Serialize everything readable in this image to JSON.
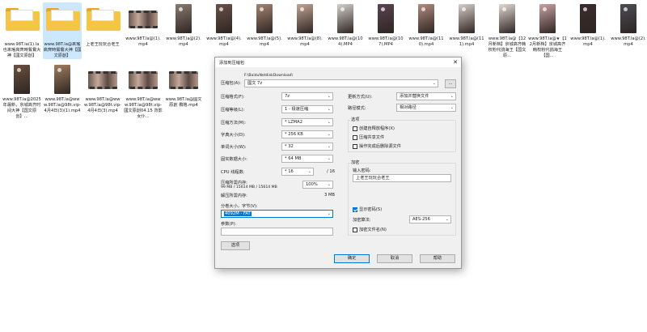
{
  "desktop": {
    "files": [
      {
        "label": "www.98T.la(1).la也來瑤高齊時鴛鴦大神【國文原創】",
        "type": "folder"
      },
      {
        "label": "www.98T.la@來瑤高齊時鴛鴦大神【國文原創】",
        "type": "folder",
        "selected": true
      },
      {
        "label": "上老王玩玩合老王",
        "type": "folder"
      },
      {
        "label": "www.98T.la@(1).mp4",
        "type": "video"
      },
      {
        "label": "www.98T.la@(2).mp4",
        "type": "photo",
        "color": "#8a7b70"
      },
      {
        "label": "www.98T.la@(4).mp4",
        "type": "photo",
        "color": "#6b5148"
      },
      {
        "label": "www.98T.la@(5).mp4",
        "type": "photo",
        "color": "#a58573"
      },
      {
        "label": "www.98T.la@(8).mp4",
        "type": "photo",
        "color": "#c3a594"
      },
      {
        "label": "www.98T.la@(104).MP4",
        "type": "photo",
        "color": "#d4d0cc"
      },
      {
        "label": "www.98T.la@(107).MP4",
        "type": "photo",
        "color": "#5a4452"
      },
      {
        "label": "www.98T.la@(110).mp4",
        "type": "photo",
        "color": "#b28c7e"
      },
      {
        "label": "www.98T.la@(111).mp4",
        "type": "photo",
        "color": "#d8cfc8"
      },
      {
        "label": "www.98T.la@【12月新档】京城高齐韩权粉代鸽海王【国文原...",
        "type": "photo",
        "color": "#e2d8d4"
      },
      {
        "label": "www.98T.la@★【12月新档】京城高齐韩权粉代鸽海王【国...",
        "type": "photo",
        "color": "#c9a4a4"
      },
      {
        "label": "www.98T.la@(1).mp4",
        "type": "photo",
        "color": "#3b2c2c"
      },
      {
        "label": "www.98T.la@(2).mp4",
        "type": "photo",
        "color": "#4b4d55"
      },
      {
        "label": "www.98T.la@2025年最新，京城高齐时间大神【国文原创】...",
        "type": "photo",
        "color": "#6a5040"
      },
      {
        "label": "www.98T.la@www.98T.la@98t.vip-4月4日(3)(1).mp4",
        "type": "photo",
        "color": "#a07e60"
      },
      {
        "label": "www.98T.la@www.98T.la@98t.vip-4月4日(3).mp4",
        "type": "video"
      },
      {
        "label": "www.98T.la@www.98T.la@98t.vip-國文原創04.15 背影女仆...",
        "type": "video"
      },
      {
        "label": "www.98T.la@國文原創 橢格.mp4",
        "type": "video"
      }
    ]
  },
  "dialog": {
    "title": "添加到压缩包",
    "close": "✕",
    "archive_label": "压缩包(A):",
    "archive_path": "F:\\BaiduNetdiskDownload\\",
    "archive_name": "國文 7z",
    "browse": "...",
    "format_label": "压缩格式(F):",
    "format_value": "7z",
    "level_label": "压缩等级(L):",
    "level_value": "1 - 极速压缩",
    "method_label": "压缩方法(M):",
    "method_value": "* LZMA2",
    "dict_label": "字典大小(D):",
    "dict_value": "* 256 KB",
    "word_label": "单词大小(W):",
    "word_value": "* 32",
    "solid_label": "固实数据大小:",
    "solid_value": "* 64 MB",
    "cpu_label": "CPU 线程数:",
    "cpu_value": "* 16",
    "cpu_total": "/ 16",
    "mem_label": "压缩所需内存:",
    "mem_detail": "99 MB / 15614 MB / 15614 MB",
    "mem_pct": "100%",
    "decomp_label": "解压所需内存:",
    "decomp_value": "3 MB",
    "split_label": "分卷大小，字节(V):",
    "split_value": "4092M - FAT",
    "params_label": "参数(P):",
    "options_btn": "选项",
    "update_label": "更新方式(U):",
    "update_value": "添加并替换文件",
    "pathmode_label": "路径模式:",
    "pathmode_value": "相对路径",
    "options_group": "选项",
    "opt_sfx": "创建自释放程序(X)",
    "opt_shared": "压缩共享文件",
    "opt_delete": "操作完成后删除源文件",
    "encrypt_group": "加密",
    "pwd_label": "输入密码:",
    "pwd_value": "上老王玩玩合老王",
    "show_pwd": "显示密码(S)",
    "enc_method_label": "加密算法:",
    "enc_method_value": "AES-256",
    "enc_names": "加密文件名(N)",
    "ok": "确定",
    "cancel": "取消",
    "help": "帮助"
  }
}
